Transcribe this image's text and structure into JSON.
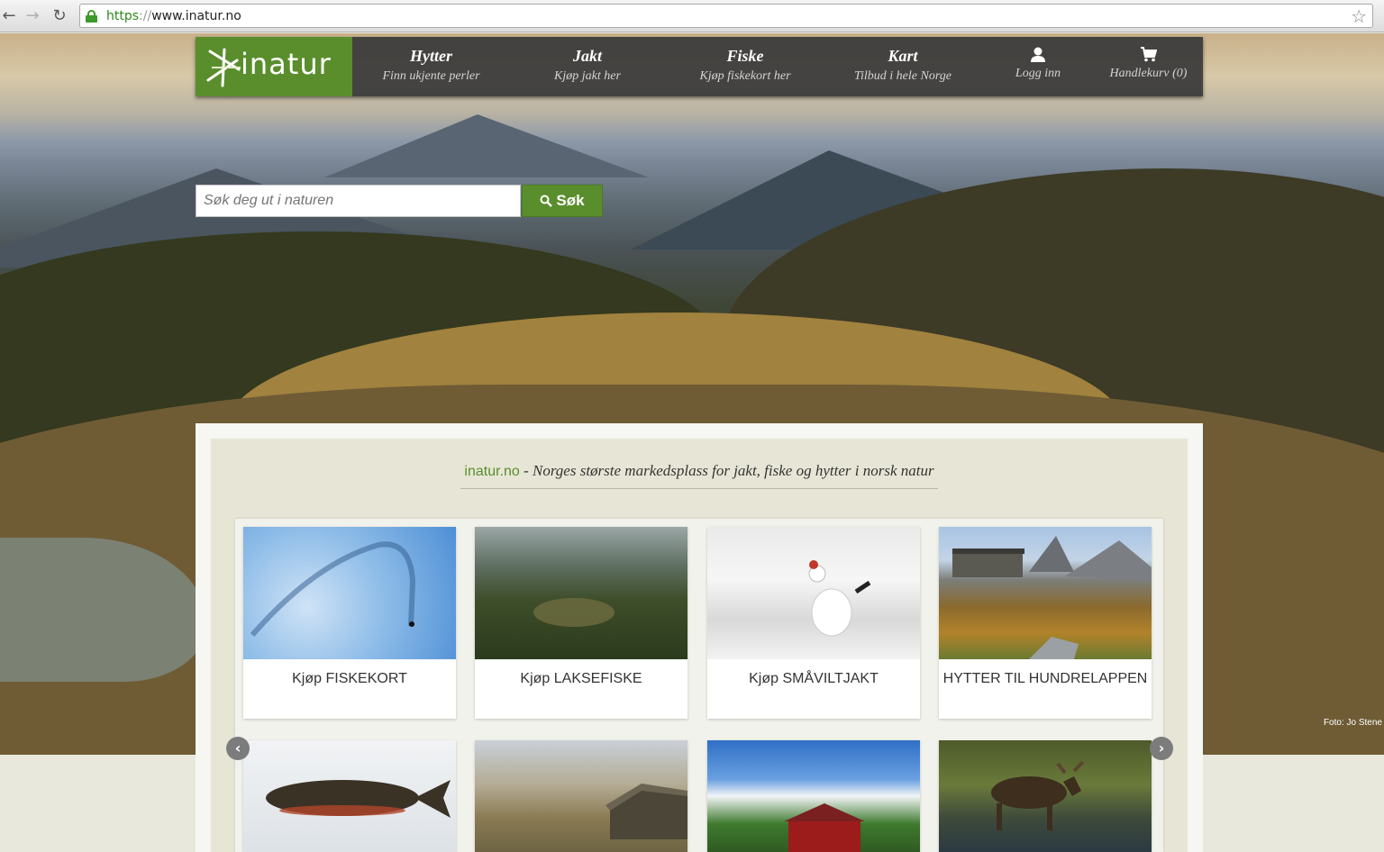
{
  "browser": {
    "url_scheme": "https",
    "url_sep": "://",
    "url_host": "www.inatur.no",
    "back_icon": "←",
    "forward_icon": "→",
    "reload_icon": "↻",
    "star_icon": "☆"
  },
  "logo": {
    "text": "inatur"
  },
  "nav": [
    {
      "title": "Hytter",
      "subtitle": "Finn ukjente perler"
    },
    {
      "title": "Jakt",
      "subtitle": "Kjøp jakt her"
    },
    {
      "title": "Fiske",
      "subtitle": "Kjøp fiskekort her"
    },
    {
      "title": "Kart",
      "subtitle": "Tilbud i hele Norge"
    }
  ],
  "login": {
    "label": "Logg inn",
    "icon": "user-icon"
  },
  "cart": {
    "label": "Handlekurv (0)",
    "icon": "cart-icon"
  },
  "search": {
    "placeholder": "Søk deg ut i naturen",
    "button_label": "Søk"
  },
  "tagline": {
    "site": "inatur.no",
    "text": " - Norges største markedsplass for jakt, fiske og hytter i norsk natur"
  },
  "tiles": [
    {
      "caption": "Kjøp FISKEKORT"
    },
    {
      "caption": "Kjøp LAKSEFISKE"
    },
    {
      "caption": "Kjøp SMÅVILTJAKT"
    },
    {
      "caption": "HYTTER TIL HUNDRELAPPEN"
    }
  ],
  "carousel": {
    "prev_icon": "‹",
    "next_icon": "›"
  },
  "photo_credit": "Foto: Jo Stene",
  "colors": {
    "brand_green": "#5a8e2d",
    "nav_bg": "#3a3a3a",
    "panel_bg": "#e7e6d6"
  }
}
